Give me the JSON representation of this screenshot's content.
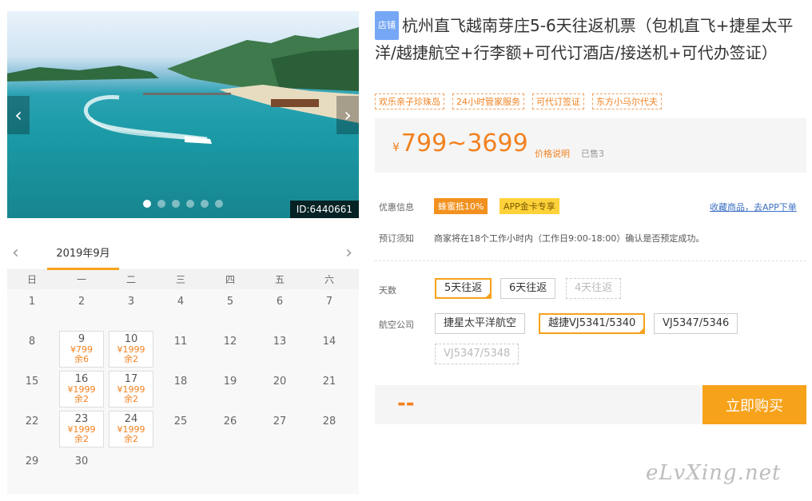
{
  "carousel": {
    "prev_arrow": "‹",
    "next_arrow": "›",
    "image_id": "ID:6440661",
    "slide_count": 6,
    "active_slide": 1
  },
  "calendar": {
    "month": "2019年9月",
    "prev_icon": "‹",
    "next_icon": "›",
    "weekdays": [
      "日",
      "一",
      "二",
      "三",
      "四",
      "五",
      "六"
    ],
    "weeks": [
      [
        {
          "d": "1"
        },
        {
          "d": "2"
        },
        {
          "d": "3"
        },
        {
          "d": "4"
        },
        {
          "d": "5"
        },
        {
          "d": "6"
        },
        {
          "d": "7"
        }
      ],
      [
        {
          "d": "8"
        },
        {
          "d": "9",
          "p": "¥799",
          "s": "余6"
        },
        {
          "d": "10",
          "p": "¥1999",
          "s": "余2"
        },
        {
          "d": "11"
        },
        {
          "d": "12"
        },
        {
          "d": "13"
        },
        {
          "d": "14"
        }
      ],
      [
        {
          "d": "15"
        },
        {
          "d": "16",
          "p": "¥1999",
          "s": "余2"
        },
        {
          "d": "17",
          "p": "¥1999",
          "s": "余2"
        },
        {
          "d": "18"
        },
        {
          "d": "19"
        },
        {
          "d": "20"
        },
        {
          "d": "21"
        }
      ],
      [
        {
          "d": "22"
        },
        {
          "d": "23",
          "p": "¥1999",
          "s": "余2"
        },
        {
          "d": "24",
          "p": "¥1999",
          "s": "余2"
        },
        {
          "d": "25"
        },
        {
          "d": "26"
        },
        {
          "d": "27"
        },
        {
          "d": "28"
        }
      ],
      [
        {
          "d": "29"
        },
        {
          "d": "30"
        },
        {
          "d": ""
        },
        {
          "d": ""
        },
        {
          "d": ""
        },
        {
          "d": ""
        },
        {
          "d": ""
        }
      ]
    ]
  },
  "product": {
    "shop_badge": "店铺",
    "title": "杭州直飞越南芽庄5-6天往返机票（包机直飞+捷星太平洋/越捷航空+行李额+可代订酒店/接送机+可代办签证）",
    "tags": [
      "欢乐亲子珍珠岛",
      "24小时管家服务",
      "可代订签证",
      "东方小马尔代夫"
    ],
    "price_symbol": "¥",
    "price_range": "799~3699",
    "price_note": "价格说明",
    "sold": "已售3"
  },
  "offers": {
    "label": "优惠信息",
    "promo_a": "蜂蜜抵10%",
    "promo_b": "APP金卡专享",
    "fav_link": "收藏商品，去APP下单"
  },
  "notice": {
    "label": "预订须知",
    "text": "商家将在18个工作小时内（工作日9:00-18:00）确认是否预定成功。"
  },
  "days_opt": {
    "label": "天数",
    "options": [
      "5天往返",
      "6天往返",
      "4天往返"
    ]
  },
  "airline_opt": {
    "label": "航空公司",
    "options": [
      "捷星太平洋航空",
      "越捷VJ5341/5340",
      "VJ5347/5346",
      "VJ5347/5348"
    ]
  },
  "buy": {
    "total": "--",
    "button": "立即购买"
  },
  "watermark": "eLvXing.net"
}
